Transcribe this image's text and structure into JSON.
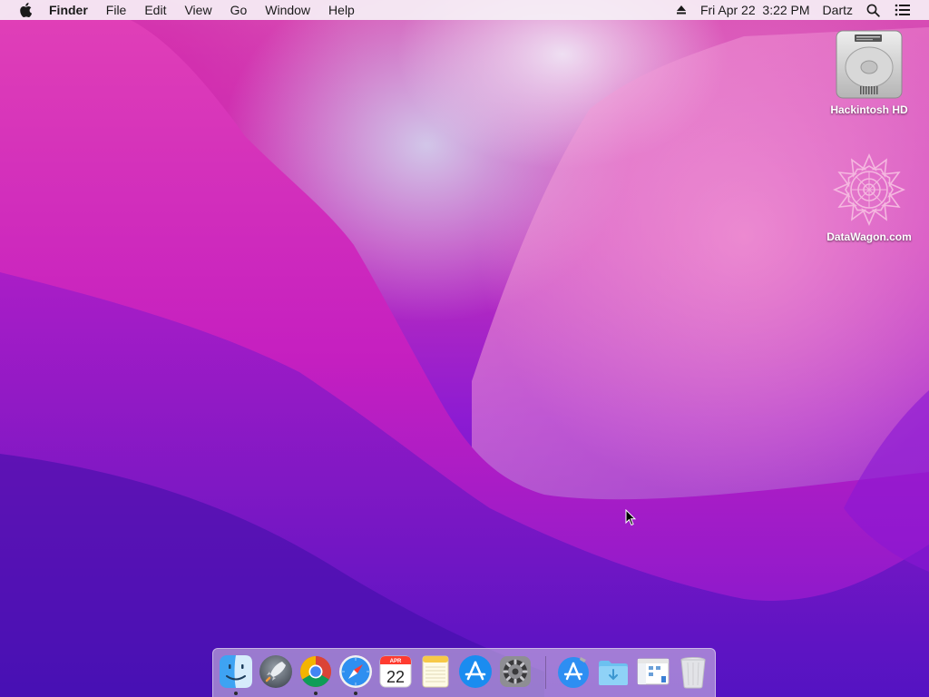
{
  "menubar": {
    "app_name": "Finder",
    "menus": [
      "File",
      "Edit",
      "View",
      "Go",
      "Window",
      "Help"
    ],
    "datetime": "Fri Apr 22  3:22 PM",
    "user": "Dartz"
  },
  "desktop_icons": [
    {
      "label": "Hackintosh HD",
      "icon": "hard-drive-icon"
    },
    {
      "label": "DataWagon.com",
      "icon": "mandala-icon"
    }
  ],
  "dock": {
    "items": [
      {
        "icon": "finder-icon",
        "running": true
      },
      {
        "icon": "launchpad-icon",
        "running": false
      },
      {
        "icon": "chrome-icon",
        "running": true
      },
      {
        "icon": "safari-icon",
        "running": true
      },
      {
        "icon": "calendar-icon",
        "running": false,
        "month": "APR",
        "day": "22"
      },
      {
        "icon": "notes-icon",
        "running": false
      },
      {
        "icon": "app-store-icon",
        "running": false
      },
      {
        "icon": "system-preferences-icon",
        "running": false
      },
      {
        "icon": "app-store-folder-icon",
        "running": false
      },
      {
        "icon": "downloads-folder-icon",
        "running": false
      },
      {
        "icon": "finder-window-icon",
        "running": false
      },
      {
        "icon": "trash-icon",
        "running": false
      }
    ]
  },
  "colors": {
    "menubar_bg": "#f6f0f6",
    "wallpaper_top": "#d94fb3",
    "wallpaper_bottom": "#4a10b5",
    "dock_bg": "#dcd2e6"
  }
}
